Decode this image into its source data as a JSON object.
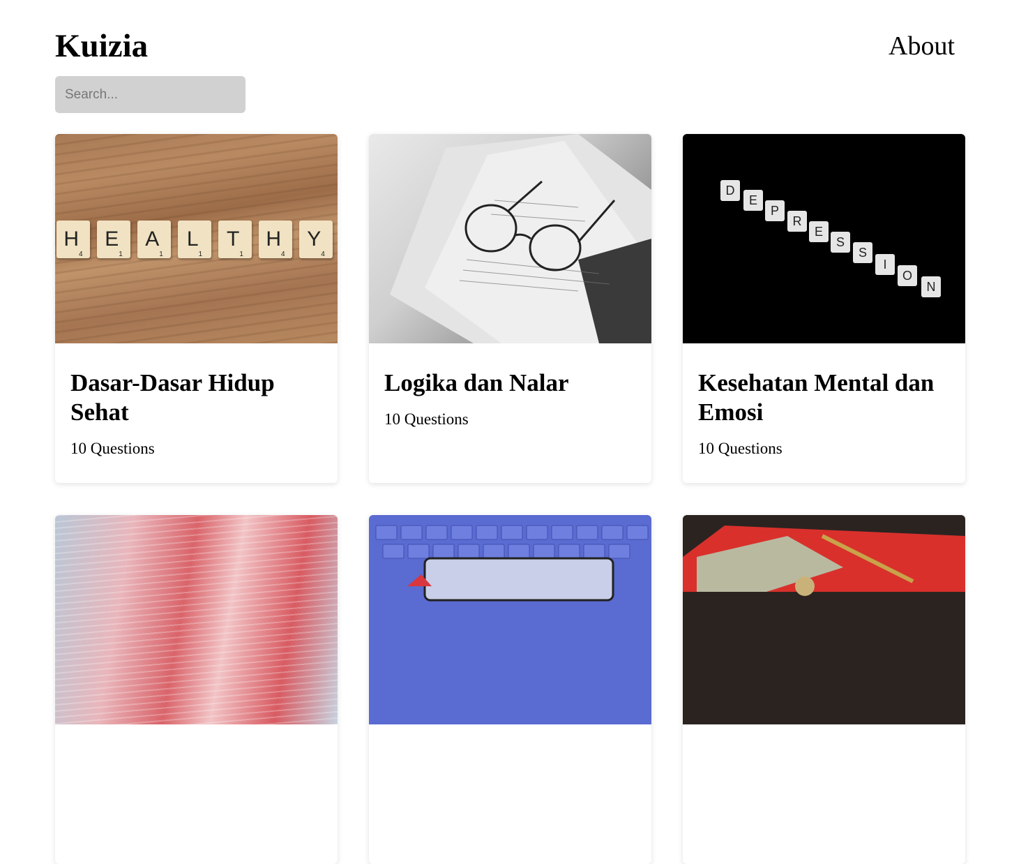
{
  "header": {
    "brand": "Kuizia",
    "nav_about": "About"
  },
  "search": {
    "placeholder": "Search..."
  },
  "quizzes": [
    {
      "title": "Dasar-Dasar Hidup Sehat",
      "count": "10 Questions",
      "image": "healthy-scrabble-tiles"
    },
    {
      "title": "Logika dan Nalar",
      "count": "10 Questions",
      "image": "glasses-on-notes"
    },
    {
      "title": "Kesehatan Mental dan Emosi",
      "count": "10 Questions",
      "image": "depression-scrabble-tiles"
    },
    {
      "title": "",
      "count": "",
      "image": "blurred-red-code"
    },
    {
      "title": "",
      "count": "",
      "image": "blue-keyboard-internet"
    },
    {
      "title": "",
      "count": "",
      "image": "money-on-red-folder"
    }
  ],
  "colors": {
    "search_bg": "#d1d1d1",
    "page_bg": "#ffffff"
  }
}
